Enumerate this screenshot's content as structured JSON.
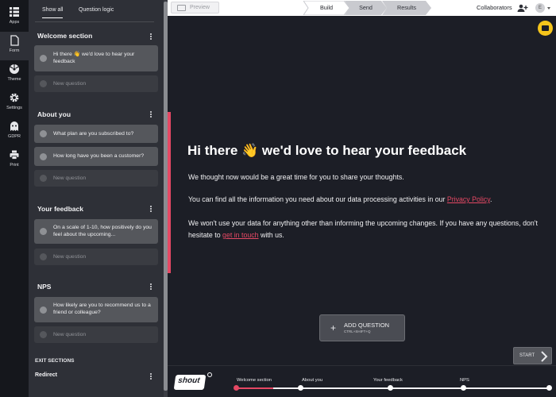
{
  "rail": [
    {
      "label": "Apps",
      "icon": "apps-grid-icon"
    },
    {
      "label": "Form",
      "icon": "form-document-icon"
    },
    {
      "label": "Theme",
      "icon": "theme-palette-icon"
    },
    {
      "label": "Settings",
      "icon": "settings-gear-icon"
    },
    {
      "label": "GDPR",
      "icon": "gdpr-ghost-icon"
    },
    {
      "label": "Print",
      "icon": "print-icon"
    }
  ],
  "sidebar": {
    "tabs": [
      "Show all",
      "Question logic"
    ],
    "sections": [
      {
        "title": "Welcome section",
        "questions": [
          "Hi there 👋 we'd love to hear your feedback"
        ],
        "new_label": "New question"
      },
      {
        "title": "About you",
        "questions": [
          "What plan are you subscribed to?",
          "How long have you been a customer?"
        ],
        "new_label": "New question"
      },
      {
        "title": "Your feedback",
        "questions": [
          "On a scale of 1-10, how positively do you feel about the upcoming..."
        ],
        "new_label": "New question"
      },
      {
        "title": "NPS",
        "questions": [
          "How likely are you to recommend us to a friend or colleague?"
        ],
        "new_label": "New question"
      }
    ],
    "exit_title": "EXIT SECTIONS",
    "redirect": "Redirect"
  },
  "topbar": {
    "preview": "Preview",
    "steps": [
      "Build",
      "Send",
      "Results"
    ],
    "active_step": "Build",
    "collaborators": "Collaborators",
    "avatar_initial": "E"
  },
  "welcome": {
    "title": "Hi there 👋 we'd love to hear your feedback",
    "para1": "We thought now would be a great time for you to share your thoughts.",
    "para2_pre": "You can find all the information you need about our data processing activities in our ",
    "para2_link": "Privacy Policy",
    "para2_post": ".",
    "para3_pre": "We won't use your data for anything other than informing the upcoming changes. If you have any questions, don't hesitate to ",
    "para3_link": "get in touch",
    "para3_post": " with us.",
    "accent_color": "#e54864"
  },
  "add_question": {
    "label": "ADD QUESTION",
    "hint": "CTRL+SHIFT+Q"
  },
  "start_button": "START",
  "bottom_nav": {
    "logo": "shout",
    "sections": [
      "Welcome section",
      "About you",
      "Your feedback",
      "NPS"
    ]
  }
}
